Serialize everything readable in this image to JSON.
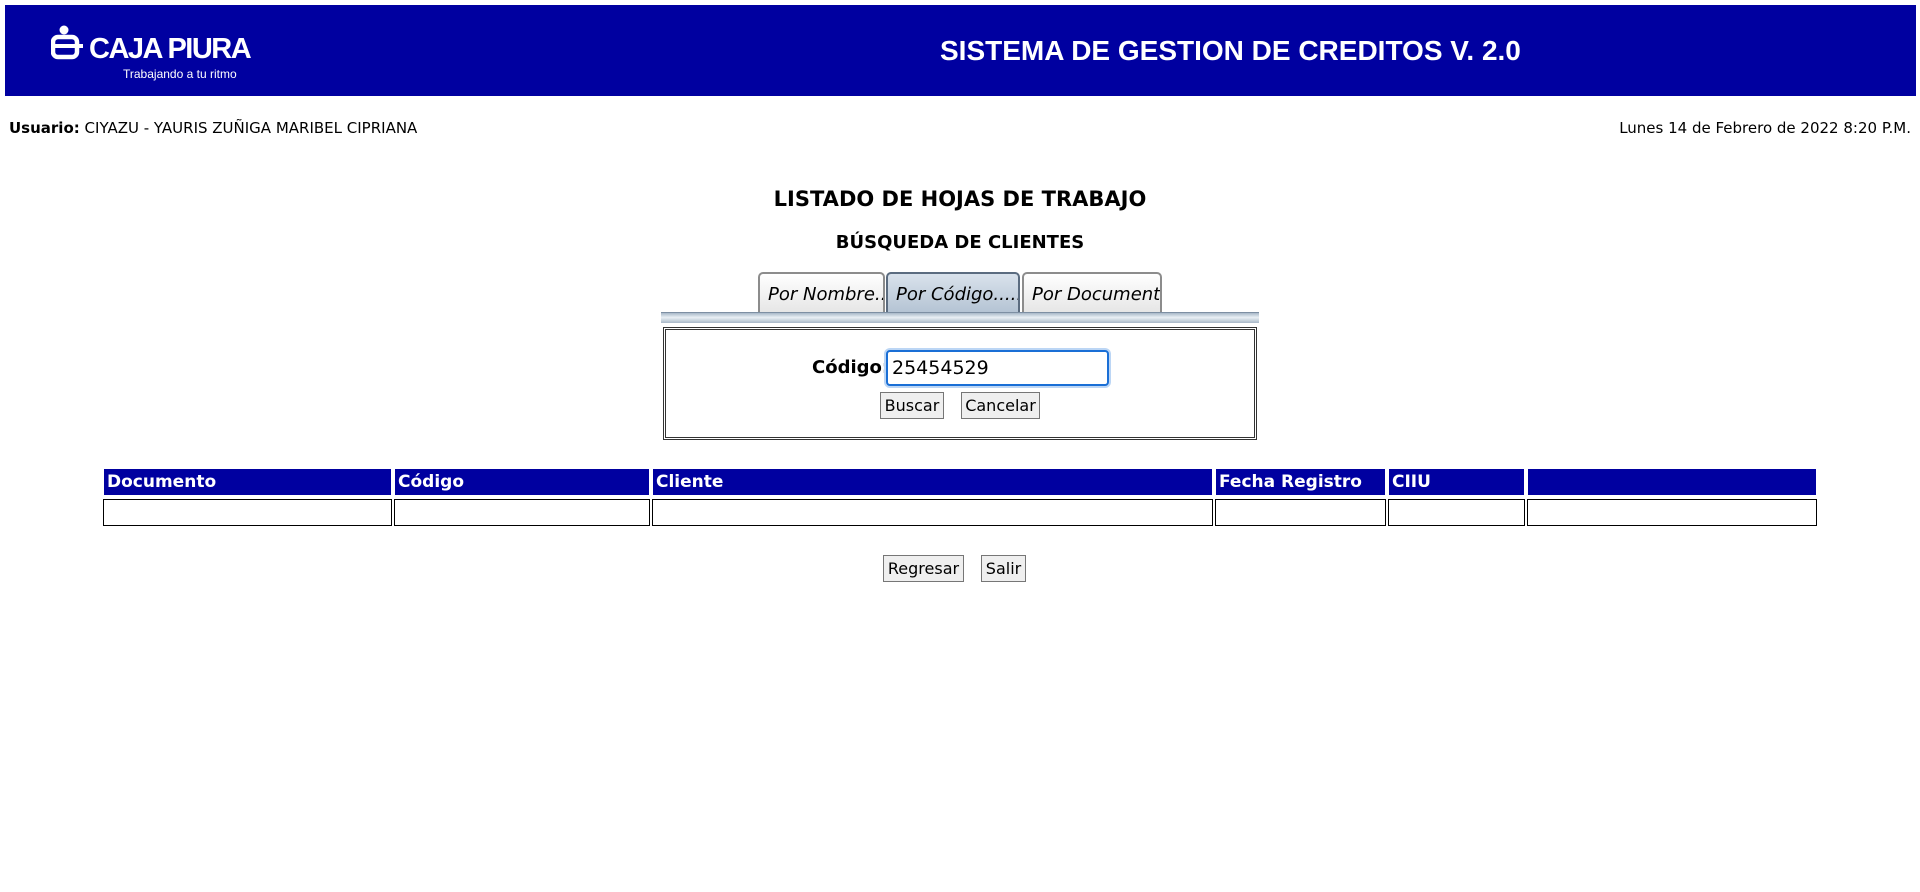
{
  "header": {
    "logo_text": "CAJA PIURA",
    "logo_slogan": "Trabajando a tu ritmo",
    "app_title": "SISTEMA DE GESTION DE CREDITOS V. 2.0",
    "background_color": "#0000a0"
  },
  "userbar": {
    "user_label": "Usuario:",
    "user_value": "CIYAZU - YAURIS ZUÑIGA MARIBEL CIPRIANA",
    "datetime": "Lunes 14 de Febrero de 2022 8:20 P.M."
  },
  "page": {
    "title": "LISTADO DE HOJAS DE TRABAJO",
    "subtitle": "BÚSQUEDA DE CLIENTES"
  },
  "tabs": [
    {
      "label": "Por Nombre...",
      "active": false
    },
    {
      "label": "Por Código......",
      "active": true
    },
    {
      "label": "Por Documento",
      "active": false
    }
  ],
  "search": {
    "field_label": "Código:",
    "field_value": "25454529",
    "search_button": "Buscar",
    "cancel_button": "Cancelar"
  },
  "table": {
    "columns": [
      "Documento",
      "Código",
      "Cliente",
      "Fecha Registro",
      "CIIU",
      ""
    ],
    "rows": []
  },
  "footer": {
    "back_button": "Regresar",
    "exit_button": "Salir"
  }
}
